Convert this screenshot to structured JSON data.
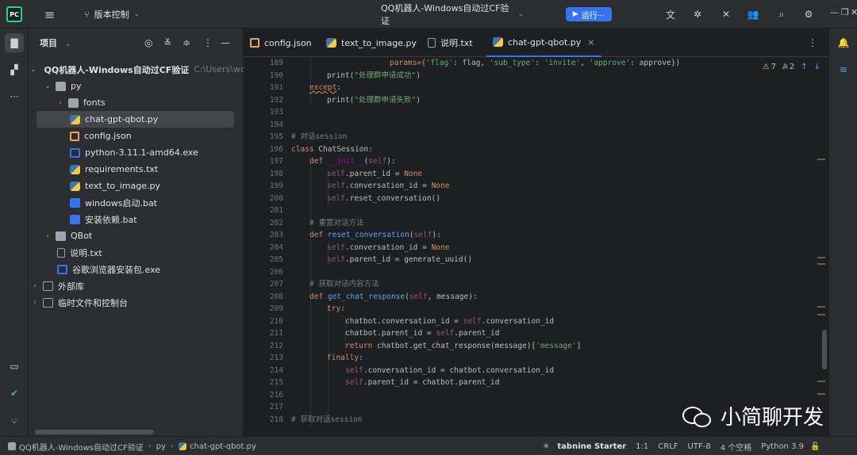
{
  "titlebar": {
    "logo_text": "PC",
    "vcs_label": "版本控制",
    "project_title": "QQ机器人-Windows自动过CF验证",
    "run_label": "运行···"
  },
  "project_panel": {
    "title": "项目",
    "tree": [
      {
        "label": "QQ机器人-Windows自动过CF验证",
        "path": "C:\\Users\\woo-m",
        "icon": "folder-icon",
        "expanded": true
      },
      {
        "label": "py",
        "icon": "folder-icon",
        "expanded": true
      },
      {
        "label": "fonts",
        "icon": "folder-icon",
        "expanded": false
      },
      {
        "label": "chat-gpt-qbot.py",
        "icon": "python-file-icon",
        "selected": true
      },
      {
        "label": "config.json",
        "icon": "json-file-icon"
      },
      {
        "label": "python-3.11.1-amd64.exe",
        "icon": "exe-file-icon"
      },
      {
        "label": "requirements.txt",
        "icon": "python-file-icon"
      },
      {
        "label": "text_to_image.py",
        "icon": "python-file-icon"
      },
      {
        "label": "windows启动.bat",
        "icon": "bat-file-icon"
      },
      {
        "label": "安装依赖.bat",
        "icon": "bat-file-icon"
      },
      {
        "label": "QBot",
        "icon": "folder-icon",
        "expanded": false
      },
      {
        "label": "说明.txt",
        "icon": "txt-file-icon"
      },
      {
        "label": "谷歌浏览器安装包.exe",
        "icon": "exe-file-icon"
      },
      {
        "label": "外部库",
        "icon": "library-icon",
        "expanded": false
      },
      {
        "label": "临时文件和控制台",
        "icon": "scratch-icon",
        "expanded": false
      }
    ]
  },
  "tabs": [
    {
      "label": "config.json",
      "icon": "json-file-icon"
    },
    {
      "label": "text_to_image.py",
      "icon": "python-file-icon"
    },
    {
      "label": "说明.txt",
      "icon": "txt-file-icon"
    },
    {
      "label": "chat-gpt-qbot.py",
      "icon": "python-file-icon",
      "active": true,
      "close": "×"
    }
  ],
  "inspections": {
    "warnings": "7",
    "typos": "2"
  },
  "code": {
    "line_numbers": [
      "189",
      "190",
      "191",
      "192",
      "193",
      "194",
      "195",
      "196",
      "197",
      "198",
      "199",
      "200",
      "201",
      "202",
      "203",
      "204",
      "205",
      "206",
      "207",
      "208",
      "209",
      "210",
      "211",
      "212",
      "213",
      "214",
      "215",
      "216",
      "217",
      "218"
    ],
    "l189_a": "params={",
    "l189_b": "'flag'",
    "l189_c": ": flag, ",
    "l189_d": "'sub_type'",
    "l189_e": ": ",
    "l189_f": "'invite'",
    "l189_g": ", ",
    "l189_h": "'approve'",
    "l189_i": ": approve})",
    "l190_a": "print(",
    "l190_b": "\"处理群申请成功\"",
    "l190_c": ")",
    "l191_a": "except",
    "l191_b": ":",
    "l192_a": "print(",
    "l192_b": "\"处理群申请失败\"",
    "l192_c": ")",
    "l195": "# 对话session",
    "l196_a": "class ",
    "l196_b": "ChatSession:",
    "l197_a": "def ",
    "l197_b": "__init__",
    "l197_c": "(",
    "l197_d": "self",
    "l197_e": "):",
    "l198_a": "self",
    "l198_b": ".parent_id = ",
    "l198_c": "None",
    "l199_a": "self",
    "l199_b": ".conversation_id = ",
    "l199_c": "None",
    "l200_a": "self",
    "l200_b": ".reset_conversation()",
    "l202": "# 重置对话方法",
    "l203_a": "def ",
    "l203_b": "reset_conversation",
    "l203_c": "(",
    "l203_d": "self",
    "l203_e": "):",
    "l204_a": "self",
    "l204_b": ".conversation_id = ",
    "l204_c": "None",
    "l205_a": "self",
    "l205_b": ".parent_id = generate_uuid()",
    "l207": "# 获取对话内容方法",
    "l208_a": "def ",
    "l208_b": "get_chat_response",
    "l208_c": "(",
    "l208_d": "self",
    "l208_e": ", message):",
    "l209_a": "try",
    "l209_b": ":",
    "l210_a": "chatbot.conversation_id = ",
    "l210_b": "self",
    "l210_c": ".conversation_id",
    "l211_a": "chatbot.parent_id = ",
    "l211_b": "self",
    "l211_c": ".parent_id",
    "l212_a": "return ",
    "l212_b": "chatbot.get_chat_response(message)[",
    "l212_c": "'message'",
    "l212_d": "]",
    "l213_a": "finally",
    "l213_b": ":",
    "l214_a": "self",
    "l214_b": ".conversation_id = chatbot.conversation_id",
    "l215_a": "self",
    "l215_b": ".parent_id = chatbot.parent_id",
    "l218": "# 获取对话session"
  },
  "watermark": {
    "text": "小简聊开发"
  },
  "statusbar": {
    "crumb_project": "QQ机器人-Windows自动过CF验证",
    "crumb_folder": "py",
    "crumb_file": "chat-gpt-qbot.py",
    "tabnine": "tabnine Starter",
    "position": "1:1",
    "line_sep": "CRLF",
    "encoding": "UTF-8",
    "indent": "4 个空格",
    "interpreter": "Python 3.9"
  },
  "colors": {
    "accent": "#3574f0",
    "keyword": "#cf8e6d",
    "string": "#6aab73",
    "function": "#56a8f5",
    "self": "#94558d"
  }
}
